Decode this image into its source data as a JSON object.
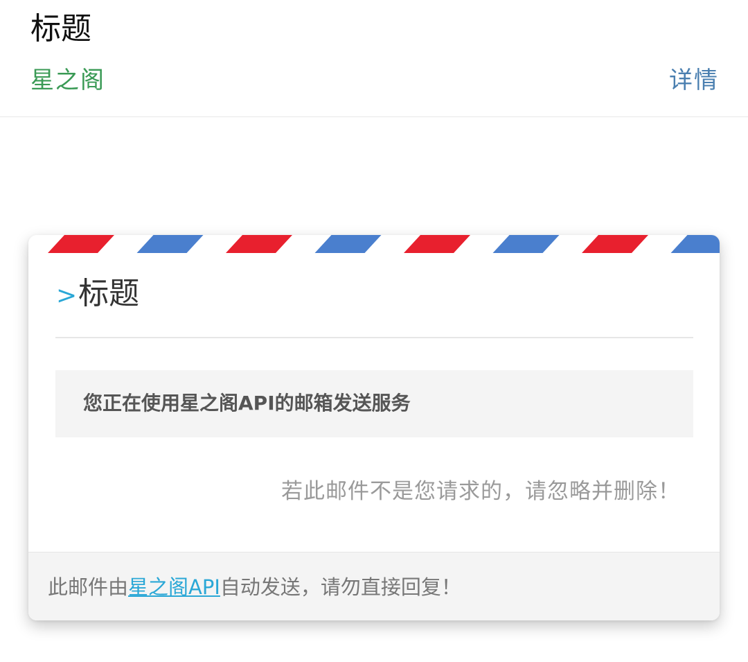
{
  "header": {
    "subject": "标题",
    "sender": "星之阁",
    "details_label": "详情"
  },
  "card": {
    "stripe_colors": [
      "#e8202e",
      "#4a7fce"
    ],
    "title_prefix": ">",
    "title": "标题",
    "message": "您正在使用星之阁API的邮箱发送服务",
    "notice": "若此邮件不是您请求的，请忽略并删除！",
    "footer": {
      "prefix": "此邮件由",
      "link_text": "星之阁API",
      "suffix": "自动发送，请勿直接回复！"
    },
    "accent_color": "#2aa7d6"
  }
}
